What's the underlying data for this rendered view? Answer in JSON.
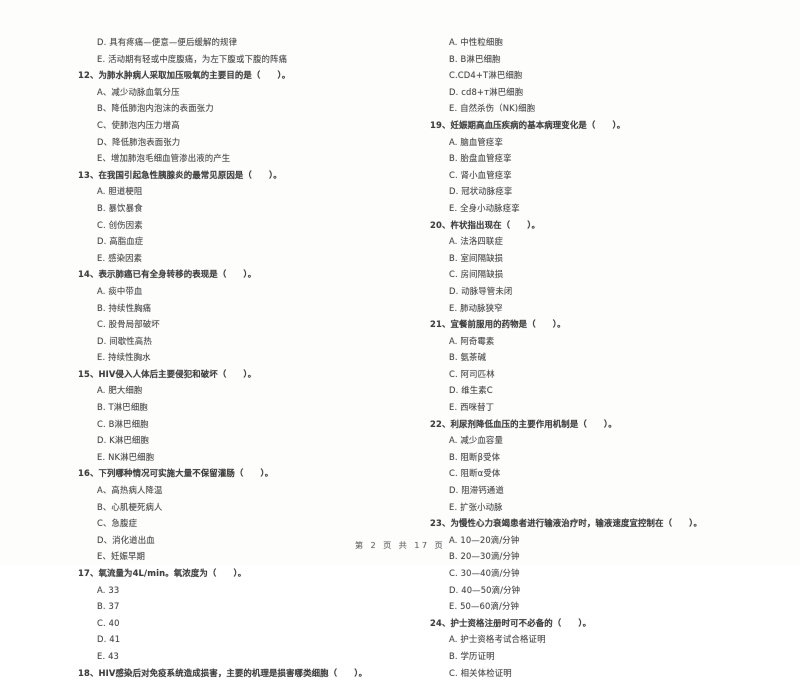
{
  "document": {
    "type": "scanned-exam-paper",
    "footer": "第 2 页  共 17 页"
  },
  "left_column": {
    "orphan_options": [
      "D. 具有疼痛—便意—便后缓解的规律",
      "E. 活动期有轻或中度腹痛，为左下腹或下腹的阵痛"
    ],
    "questions": [
      {
        "stem": "12、为肺水肿病人采取加压吸氧的主要目的是（　　）。",
        "options": [
          "A、减少动脉血氧分压",
          "B、降低肺泡内泡沫的表面张力",
          "C、使肺泡内压力增高",
          "D、降低肺泡表面张力",
          "E、增加肺泡毛细血管渗出液的产生"
        ]
      },
      {
        "stem": "13、在我国引起急性胰腺炎的最常见原因是（　　）。",
        "options": [
          "A. 胆道梗阻",
          "B. 暴饮暴食",
          "C. 创伤因素",
          "D. 高脂血症",
          "E. 感染因素"
        ]
      },
      {
        "stem": "14、表示肺癌已有全身转移的表现是（　　）。",
        "options": [
          "A. 痰中带血",
          "B. 持续性胸痛",
          "C. 股骨局部破坏",
          "D. 间歇性高热",
          "E. 持续性胸水"
        ]
      },
      {
        "stem": "15、HIV侵入人体后主要侵犯和破坏（　　）。",
        "options": [
          "A. 肥大细胞",
          "B. T淋巴细胞",
          "C. B淋巴细胞",
          "D. K淋巴细胞",
          "E. NK淋巴细胞"
        ]
      },
      {
        "stem": "16、下列哪种情况可实施大量不保留灌肠（　　）。",
        "options": [
          "A、高热病人降温",
          "B、心肌梗死病人",
          "C、急腹症",
          "D、消化道出血",
          "E、妊娠早期"
        ]
      },
      {
        "stem": "17、氧流量为4L/min。氧浓度为（　　）。",
        "options": [
          "A. 33",
          "B. 37",
          "C. 40",
          "D. 41",
          "E. 43"
        ]
      },
      {
        "stem": "18、HIV感染后对免疫系统造成损害，主要的机理是损害哪类细胞（　　）。",
        "options": []
      }
    ]
  },
  "right_column": {
    "orphan_options": [
      "A. 中性粒细胞",
      "B. B淋巴细胞",
      "C.CD4+T淋巴细胞",
      "D. cd8+т淋巴细胞",
      "E. 自然杀伤（NK)细胞"
    ],
    "questions": [
      {
        "stem": "19、妊娠期高血压疾病的基本病理变化是（　　）。",
        "options": [
          "A. 脑血管痉挛",
          "B. 胎盘血管痉挛",
          "C. 肾小血管痉挛",
          "D. 冠状动脉痉挛",
          "E. 全身小动脉痉挛"
        ]
      },
      {
        "stem": "20、杵状指出现在（　　）。",
        "options": [
          "A. 法洛四联症",
          "B. 室间隔缺损",
          "C. 房间隔缺损",
          "D. 动脉导管未闭",
          "E. 肺动脉狭窄"
        ]
      },
      {
        "stem": "21、宜餐前服用的药物是（　　）。",
        "options": [
          "A. 阿奇霉素",
          "B. 氨茶碱",
          "C. 阿司匹林",
          "D. 维生素C",
          "E. 西咪替丁"
        ]
      },
      {
        "stem": "22、利尿剂降低血压的主要作用机制是（　　）。",
        "options": [
          "A. 减少血容量",
          "B. 阻断β受体",
          "C. 阻断α受体",
          "D. 阻滞钙通道",
          "E. 扩张小动脉"
        ]
      },
      {
        "stem": "23、为慢性心力衰竭患者进行输液治疗时，输液速度宜控制在（　　）。",
        "options": [
          "A. 10—20滴/分钟",
          "B. 20—30滴/分钟",
          "C. 30—40滴/分钟",
          "D. 40—50滴/分钟",
          "E. 50—60滴/分钟"
        ]
      },
      {
        "stem": "24、护士资格注册时可不必备的（　　）。",
        "options": [
          "A. 护士资格考试合格证明",
          "B. 学历证明",
          "C. 相关体检证明"
        ]
      }
    ]
  }
}
